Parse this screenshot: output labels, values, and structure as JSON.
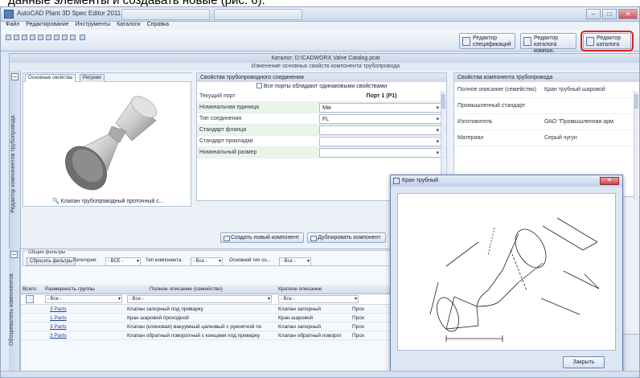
{
  "caption": "данные элементы и создавать новые (рис. 6).",
  "window": {
    "title": "AutoCAD Plant 3D Spec Editor 2011",
    "title_tabs": [
      "",
      ""
    ],
    "controls": {
      "minimize": "–",
      "maximize": "□",
      "close": "✕"
    }
  },
  "menu": [
    "Файл",
    "Редактирование",
    "Инструменты",
    "Каталоги",
    "Справка"
  ],
  "toolbar": {
    "buttons": [
      {
        "label_line1": "Редактор",
        "label_line2": "спецификаций",
        "icon": "spec-editor-icon"
      },
      {
        "label_line1": "Редактор",
        "label_line2": "каталога компон.",
        "icon": "catalog-editor-icon"
      },
      {
        "label_line1": "Редактор",
        "label_line2": "каталога",
        "icon": "catalog-icon",
        "highlighted": true
      }
    ]
  },
  "panel": {
    "title": "Каталог: D:\\CADWORX Valve Catalog.pcat",
    "subtitle": "Изменение основных свойств компонента трубопровода",
    "side_label": "Редактор компонентов трубопровода",
    "image_tabs": [
      "Основные свойства",
      "Рисунки"
    ],
    "image_label": "Клапан трубопроводный проточный с...",
    "props_title": "Свойства трубопроводного соединения",
    "props_checkbox": "Все порты обладают одинаковыми свойствами",
    "props": [
      {
        "key": "Текущий порт",
        "value": "Порт 1 (P1)",
        "bold": true
      },
      {
        "key": "Номинальная единица",
        "value": "Мм",
        "dropdown": true,
        "alt": true
      },
      {
        "key": "Тип соединения",
        "value": "FL",
        "dropdown": true
      },
      {
        "key": "Стандарт фланца",
        "value": "",
        "alt": true
      },
      {
        "key": "Стандарт прокладки",
        "value": ""
      },
      {
        "key": "Номинальный размер",
        "value": "",
        "alt": true
      }
    ],
    "comp_title": "Свойства компонента трубопровода",
    "comp_props": [
      {
        "key": "Полное описание (семейство)",
        "value": "Кран трубный шаровой"
      },
      {
        "key": "Промышленный стандарт",
        "value": ""
      },
      {
        "key": "Изготовитель",
        "value": "ОАО \"Промышленная арм"
      },
      {
        "key": "Материал",
        "value": "Серый чугун"
      }
    ],
    "buttons": [
      "Создать новый компонент",
      "Дублировать компонент"
    ]
  },
  "lower": {
    "side_label": "Обозреватель компонентов",
    "filter_group": "Общие фильтры",
    "reset_button": "Сбросить фильтры",
    "category_label": "Категория:",
    "category_value": "- ВСЕ -",
    "type_label": "Тип компонента:",
    "type_value": "- Все -",
    "conn_label": "Основной тип со...",
    "conn_value": "- Все -",
    "columns": [
      "Всего",
      "Размерность группы",
      "Полное описание (семейство)",
      "Краткое описание"
    ],
    "filter_values": [
      "- Все -",
      "- Все -",
      "- Все -"
    ],
    "rows": [
      {
        "size": "3 Parts",
        "desc": "Клапан запорный под приварку",
        "short": "Клапан запорный",
        "extra": "Прох"
      },
      {
        "size": "1 Parts",
        "desc": "Кран шаровой проходной",
        "short": "Кран шаровой",
        "extra": "Прох"
      },
      {
        "size": "3 Parts",
        "desc": "Клапан (клиновая) вакуумный цапковый с рукояткой по",
        "short": "Клапан запорный",
        "extra": "Прох"
      },
      {
        "size": "3 Parts",
        "desc": "Клапан обратный поворотный с концами под приварку",
        "short": "Клапан обратный поворот",
        "extra": "Прох"
      }
    ]
  },
  "popup": {
    "title": "Кран трубный",
    "close": "✕",
    "ok_button": "Закрыть"
  }
}
